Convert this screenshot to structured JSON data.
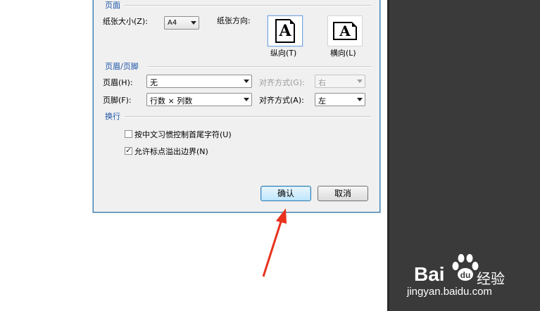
{
  "dialog": {
    "page_section": {
      "title": "页面",
      "paper_size_label": "纸张大小(Z):",
      "paper_size_value": "A4",
      "orientation_label": "纸张方向:",
      "portrait_label": "纵向(T)",
      "landscape_label": "横向(L)",
      "icon_letter": "A"
    },
    "header_footer_section": {
      "title": "页眉/页脚",
      "header_label": "页眉(H):",
      "header_value": "无",
      "header_align_label": "对齐方式(G):",
      "header_align_value": "右",
      "footer_label": "页脚(F):",
      "footer_value": "行数 × 列数",
      "footer_align_label": "对齐方式(A):",
      "footer_align_value": "左"
    },
    "wrap_section": {
      "title": "换行",
      "option1_label": "按中文习惯控制首尾字符(U)",
      "option1_checked": false,
      "option2_label": "允许标点溢出边界(N)",
      "option2_checked": true
    },
    "buttons": {
      "ok_label": "确认",
      "cancel_label": "取消"
    }
  },
  "watermark": {
    "brand": "Bai",
    "brand2": "du",
    "product": "经验",
    "url": "jingyan.baidu.com"
  },
  "colors": {
    "section_title": "#1c54a8",
    "arrow": "#e8321e",
    "dark_panel": "#3a3a3a"
  }
}
